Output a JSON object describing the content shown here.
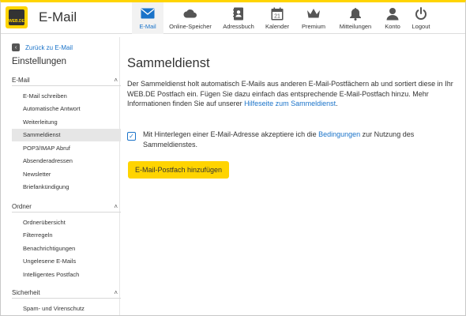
{
  "app": {
    "title": "E-Mail",
    "logo_text": "WEB.DE"
  },
  "nav": [
    {
      "key": "email",
      "label": "E-Mail",
      "icon": "envelope-icon",
      "active": true
    },
    {
      "key": "storage",
      "label": "Online-Speicher",
      "icon": "cloud-icon"
    },
    {
      "key": "contacts",
      "label": "Adressbuch",
      "icon": "address-book-icon"
    },
    {
      "key": "calendar",
      "label": "Kalender",
      "icon": "calendar-icon",
      "day": "21"
    },
    {
      "key": "premium",
      "label": "Premium",
      "icon": "crown-icon"
    },
    {
      "key": "notifications",
      "label": "Mitteilungen",
      "icon": "bell-icon"
    },
    {
      "key": "account",
      "label": "Konto",
      "icon": "person-icon"
    },
    {
      "key": "logout",
      "label": "Logout",
      "icon": "power-icon"
    }
  ],
  "sidebar": {
    "back_label": "Zurück zu E-Mail",
    "title": "Einstellungen",
    "sections": [
      {
        "label": "E-Mail",
        "items": [
          "E-Mail schreiben",
          "Automatische Antwort",
          "Weiterleitung",
          "Sammeldienst",
          "POP3/IMAP Abruf",
          "Absenderadressen",
          "Newsletter",
          "Briefankündigung"
        ],
        "active_index": 3
      },
      {
        "label": "Ordner",
        "items": [
          "Ordnerübersicht",
          "Filterregeln",
          "Benachrichtigungen",
          "Ungelesene E-Mails",
          "Intelligentes Postfach"
        ]
      },
      {
        "label": "Sicherheit",
        "items": [
          "Spam- und Virenschutz"
        ]
      }
    ]
  },
  "main": {
    "title": "Sammeldienst",
    "description": "Der Sammeldienst holt automatisch E-Mails aus anderen E-Mail-Postfächern ab und sortiert diese in Ihr WEB.DE Postfach ein. Fügen Sie dazu einfach das entsprechende E-Mail-Postfach hinzu. Mehr Informationen finden Sie auf unserer ",
    "help_link": "Hilfeseite zum Sammeldienst",
    "description_end": ".",
    "consent_checked": true,
    "consent_text_1": "Mit Hinterlegen einer E-Mail-Adresse akzeptiere ich die ",
    "consent_link": "Bedingungen",
    "consent_text_2": " zur Nutzung des Sammeldienstes.",
    "add_button": "E-Mail-Postfach hinzufügen"
  },
  "colors": {
    "accent": "#ffd400",
    "link": "#1a73c9",
    "text": "#333333"
  }
}
